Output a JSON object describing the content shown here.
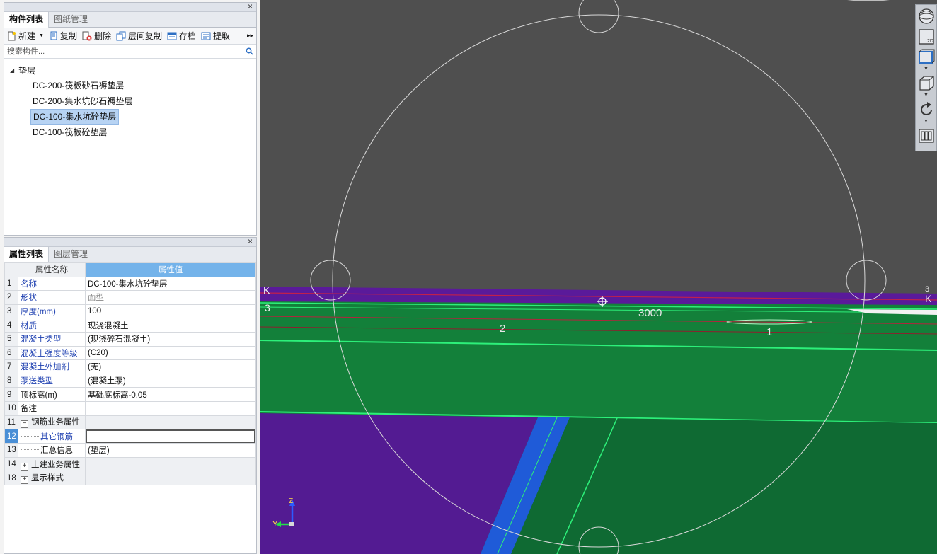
{
  "component_panel": {
    "tabs": [
      "构件列表",
      "图纸管理"
    ],
    "toolbar": {
      "new": "新建",
      "copy": "复制",
      "delete": "删除",
      "floor_copy": "层间复制",
      "archive": "存档",
      "extract": "提取"
    },
    "search_placeholder": "搜索构件...",
    "tree": {
      "root": "垫层",
      "items": [
        "DC-200-筏板砂石褥垫层",
        "DC-200-集水坑砂石褥垫层",
        "DC-100-集水坑砼垫层",
        "DC-100-筏板砼垫层"
      ],
      "selected_index": 2
    }
  },
  "property_panel": {
    "tabs": [
      "属性列表",
      "图层管理"
    ],
    "header": {
      "name": "属性名称",
      "value": "属性值"
    },
    "rows": [
      {
        "num": "1",
        "name": "名称",
        "value": "DC-100-集水坑砼垫层"
      },
      {
        "num": "2",
        "name": "形状",
        "value": "面型"
      },
      {
        "num": "3",
        "name": "厚度(mm)",
        "value": "100"
      },
      {
        "num": "4",
        "name": "材质",
        "value": "现浇混凝土"
      },
      {
        "num": "5",
        "name": "混凝土类型",
        "value": "(现浇碎石混凝土)"
      },
      {
        "num": "6",
        "name": "混凝土强度等级",
        "value": "(C20)"
      },
      {
        "num": "7",
        "name": "混凝土外加剂",
        "value": "(无)"
      },
      {
        "num": "8",
        "name": "泵送类型",
        "value": "(混凝土泵)"
      },
      {
        "num": "9",
        "name": "顶标高(m)",
        "value": "基础底标高-0.05"
      },
      {
        "num": "10",
        "name": "备注",
        "value": ""
      },
      {
        "num": "11",
        "name": "钢筋业务属性",
        "value": ""
      },
      {
        "num": "12",
        "name": "其它钢筋",
        "value": ""
      },
      {
        "num": "13",
        "name": "汇总信息",
        "value": "(垫层)"
      },
      {
        "num": "14",
        "name": "土建业务属性",
        "value": ""
      },
      {
        "num": "18",
        "name": "显示样式",
        "value": ""
      }
    ]
  },
  "viewport": {
    "labels": {
      "k_left": "K",
      "k_right": "K",
      "axis_3_left": "3",
      "axis_3_right": "3",
      "axis_2": "2",
      "axis_1": "1",
      "dimension": "3000"
    },
    "axes": {
      "y": "Y",
      "z": "Z"
    },
    "view_controls": [
      "orbit-sphere",
      "2d-view",
      "top-view",
      "3d-box-view",
      "rotate",
      "settings-panel"
    ],
    "colors": {
      "background": "#4f4f4f",
      "slab_green": "#13803a",
      "dark_green": "#0f6a33",
      "purple": "#531b92",
      "blue_band": "#1f5bd8",
      "line_green": "#2df07a"
    }
  }
}
